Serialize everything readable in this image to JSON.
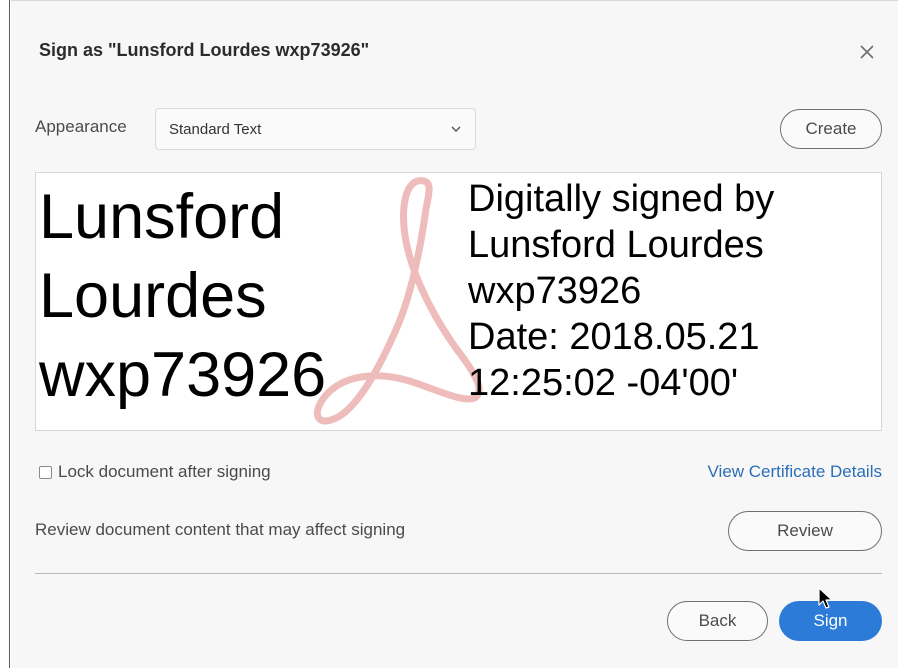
{
  "dialog": {
    "title": "Sign as \"Lunsford Lourdes wxp73926\"",
    "close_icon": "close-icon"
  },
  "appearance": {
    "label": "Appearance",
    "selected": "Standard Text",
    "create_label": "Create"
  },
  "preview": {
    "name_lines": [
      "Lunsford",
      "Lourdes",
      "wxp73926"
    ],
    "detail_lines": [
      "Digitally signed by",
      "Lunsford Lourdes",
      "wxp73926",
      "Date: 2018.05.21",
      "12:25:02 -04'00'"
    ],
    "watermark_icon": "acrobat-logo-icon"
  },
  "options": {
    "lock_label": "Lock document after signing",
    "lock_checked": false,
    "view_cert_label": "View Certificate Details"
  },
  "review": {
    "text": "Review document content that may affect signing",
    "button_label": "Review"
  },
  "footer": {
    "back_label": "Back",
    "sign_label": "Sign"
  },
  "colors": {
    "accent": "#2d7bd8",
    "link": "#2a6fb7",
    "watermark": "#e8a0a0"
  }
}
